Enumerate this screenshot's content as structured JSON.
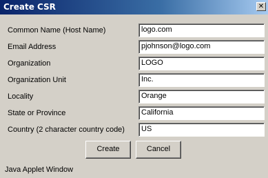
{
  "window": {
    "title": "Create CSR",
    "close_icon": "close-icon"
  },
  "form": {
    "fields": [
      {
        "label": "Common Name (Host Name)",
        "value": "logo.com"
      },
      {
        "label": "Email Address",
        "value": "pjohnson@logo.com"
      },
      {
        "label": "Organization",
        "value": "LOGO"
      },
      {
        "label": "Organization Unit",
        "value": "Inc."
      },
      {
        "label": "Locality",
        "value": "Orange"
      },
      {
        "label": "State or Province",
        "value": "California"
      },
      {
        "label": "Country (2 character country code)",
        "value": "US"
      }
    ]
  },
  "buttons": {
    "create_label": "Create",
    "cancel_label": "Cancel"
  },
  "status": {
    "text": "Java Applet Window"
  }
}
